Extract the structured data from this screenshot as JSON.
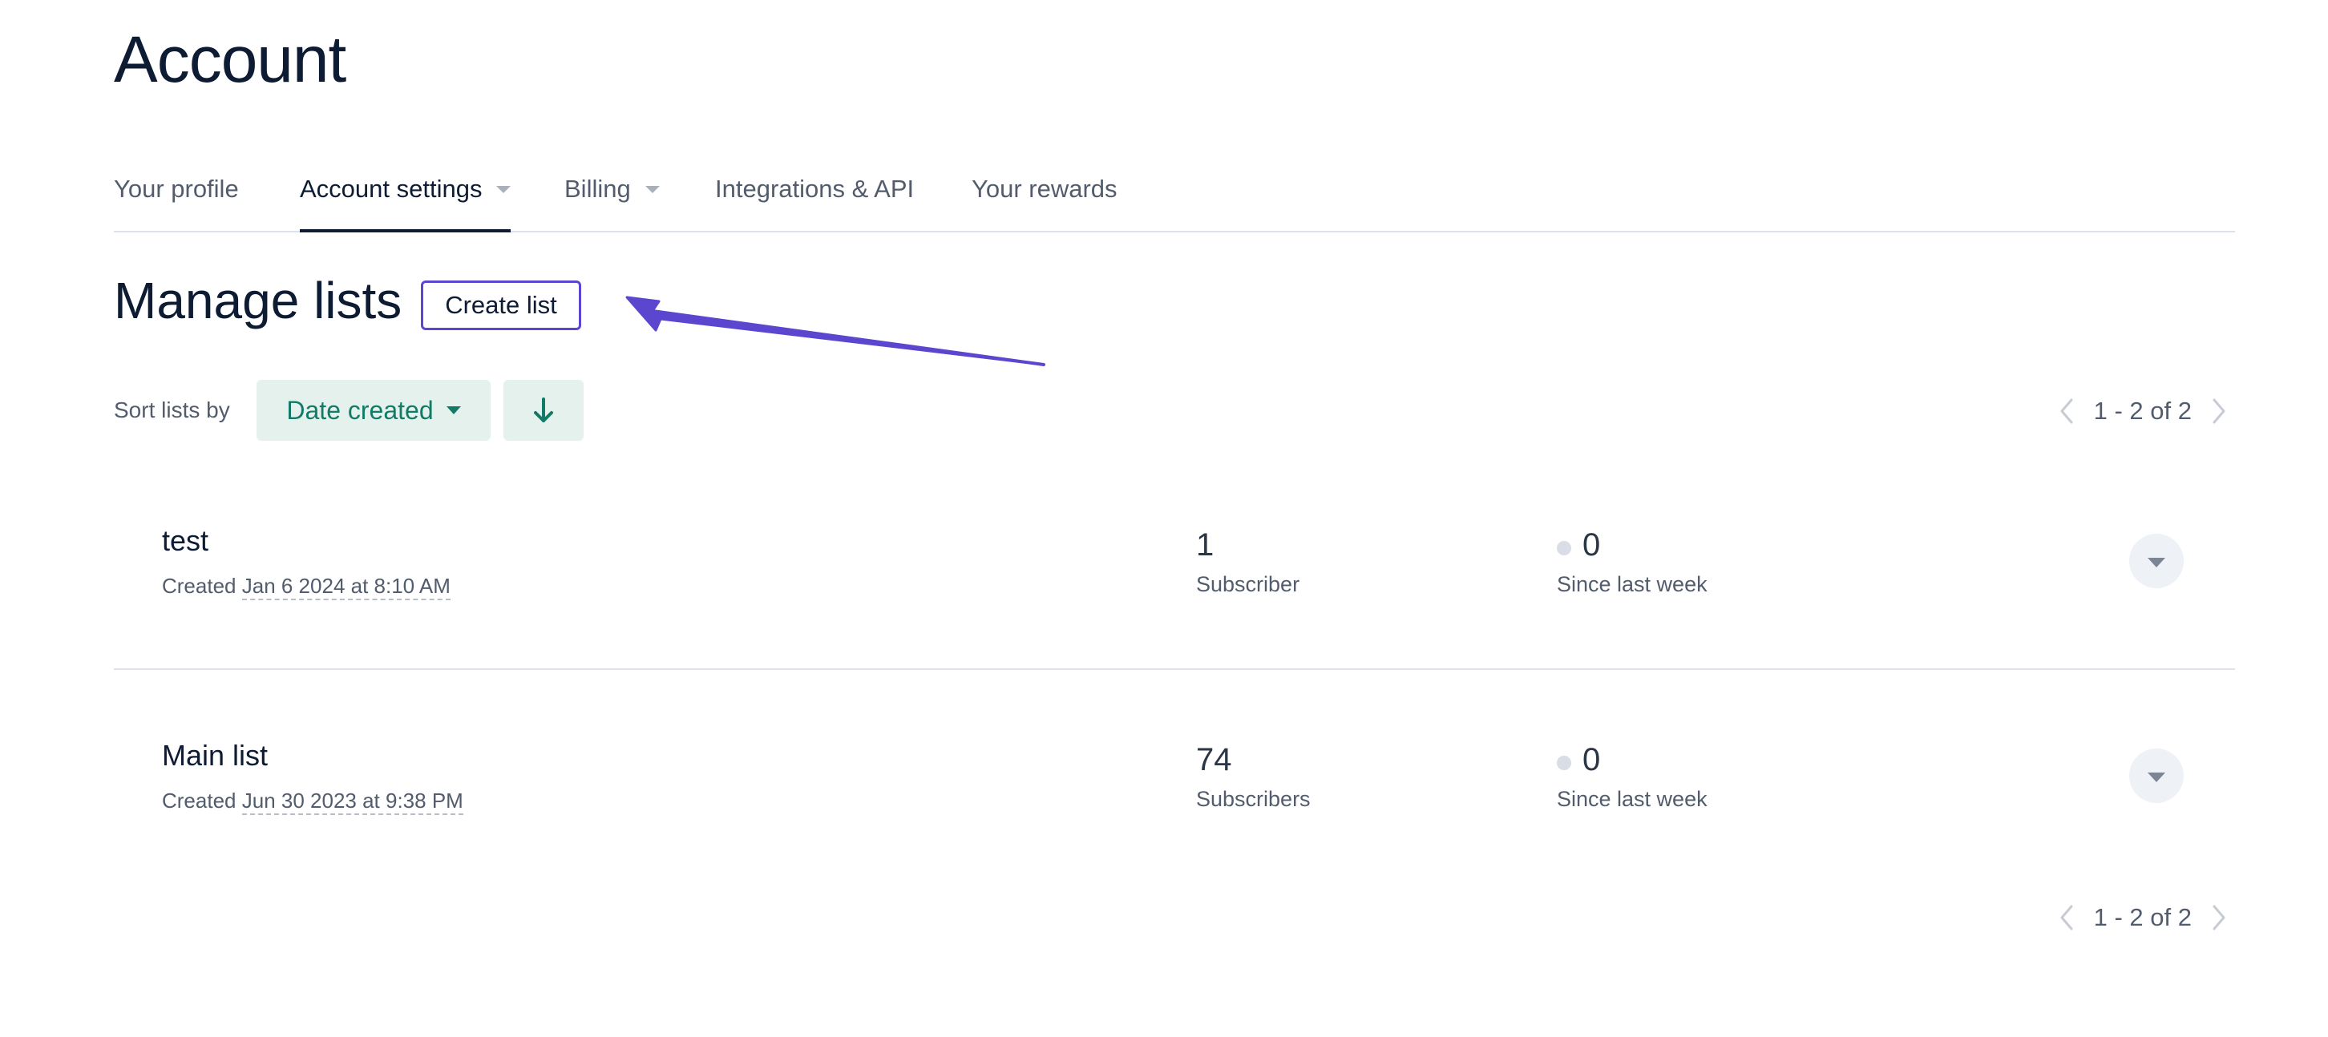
{
  "page": {
    "title": "Account"
  },
  "tabs": [
    {
      "label": "Your profile",
      "active": false,
      "has_dropdown": false
    },
    {
      "label": "Account settings",
      "active": true,
      "has_dropdown": true
    },
    {
      "label": "Billing",
      "active": false,
      "has_dropdown": true
    },
    {
      "label": "Integrations & API",
      "active": false,
      "has_dropdown": false
    },
    {
      "label": "Your rewards",
      "active": false,
      "has_dropdown": false
    }
  ],
  "manage": {
    "title": "Manage lists",
    "create_label": "Create list"
  },
  "sort": {
    "label": "Sort lists by",
    "selected": "Date created",
    "direction_icon": "arrow-down-icon"
  },
  "pagination": {
    "range": "1 - 2 of 2"
  },
  "lists": [
    {
      "name": "test",
      "created_prefix": "Created",
      "created_date": "Jan 6 2024 at 8:10 AM",
      "subscribers": "1",
      "subscribers_label": "Subscriber",
      "change": "0",
      "change_label": "Since last week"
    },
    {
      "name": "Main list",
      "created_prefix": "Created",
      "created_date": "Jun 30 2023 at 9:38 PM",
      "subscribers": "74",
      "subscribers_label": "Subscribers",
      "change": "0",
      "change_label": "Since last week"
    }
  ],
  "colors": {
    "text_primary": "#0d1b33",
    "text_secondary": "#525c6c",
    "accent_green": "#127a66",
    "accent_green_bg": "#e5f1ec",
    "annotation_purple": "#5a46cf",
    "divider": "#dde2ea"
  }
}
